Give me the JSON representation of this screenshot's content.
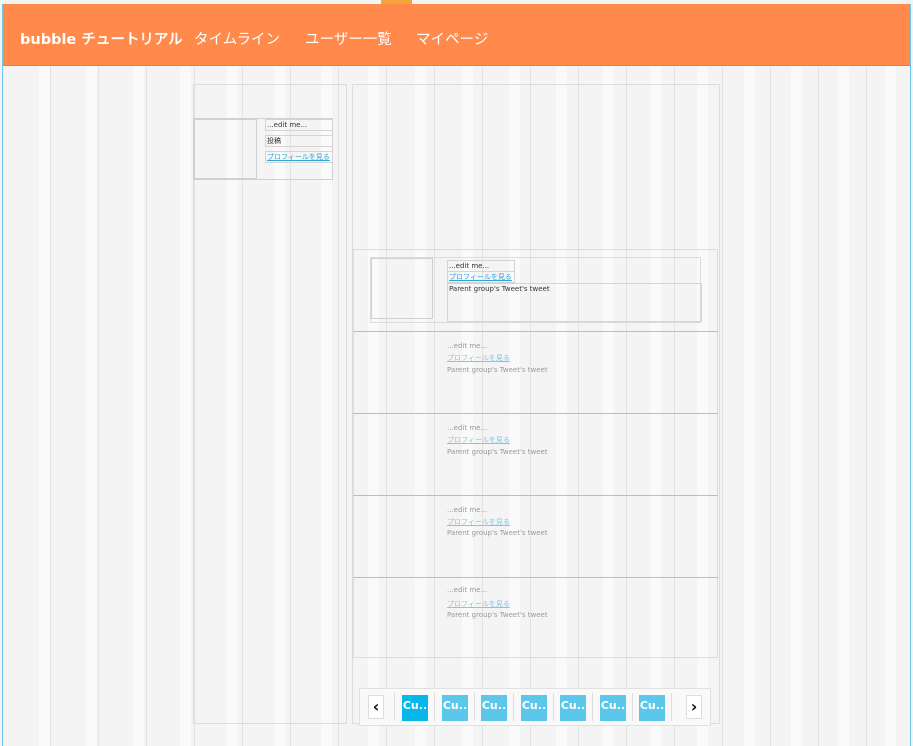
{
  "header": {
    "brand": "bubble チュートリアル",
    "nav": [
      "タイムライン",
      "ユーザー一覧",
      "マイページ"
    ]
  },
  "sidebar_card": {
    "name_text": "...edit me...",
    "post_label": "投稿",
    "profile_link": "プロフィールを見る"
  },
  "timeline": {
    "first_item": {
      "name_text": "...edit me...",
      "profile_link": "プロフィールを見る",
      "tweet_text": "Parent group's Tweet's tweet"
    },
    "repeated_items": [
      {
        "name_text": "...edit me...",
        "profile_link": "プロフィールを見る",
        "tweet_text": "Parent group's Tweet's tweet"
      },
      {
        "name_text": "...edit me...",
        "profile_link": "プロフィールを見る",
        "tweet_text": "Parent group's Tweet's tweet"
      },
      {
        "name_text": "...edit me...",
        "profile_link": "プロフィールを見る",
        "tweet_text": "Parent group's Tweet's tweet"
      },
      {
        "name_text": "...edit me...",
        "profile_link": "プロフィールを見る",
        "tweet_text": "Parent group's Tweet's tweet"
      }
    ]
  },
  "pagination": {
    "prev": "‹",
    "next": "›",
    "buttons": [
      "Cu..",
      "Cu..",
      "Cu..",
      "Cu..",
      "Cu..",
      "Cu..",
      "Cu.."
    ]
  },
  "colors": {
    "header_bg": "#ff8a4c",
    "page_button": "#5cc7ea",
    "page_button_active": "#08b7ea",
    "link": "#2ea6d8"
  }
}
